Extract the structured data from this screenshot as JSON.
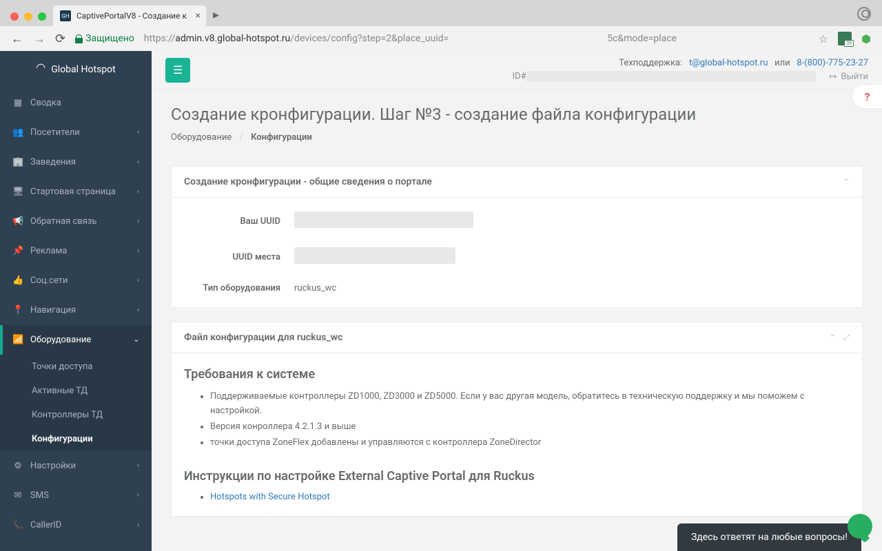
{
  "browser": {
    "tab_title": "CaptivePortalV8 - Создание к",
    "tab_favicon": "GH",
    "secure_label": "Защищено",
    "url_prefix": "https://",
    "url_host": "admin.v8.global-hotspot.ru",
    "url_path": "/devices/config?step=2&place_uuid=",
    "url_suffix": "5c&mode=place",
    "ext_badge": "39"
  },
  "sidebar": {
    "brand": "Global Hotspot",
    "items": [
      {
        "icon": "▦",
        "label": "Сводка",
        "expandable": false
      },
      {
        "icon": "👥",
        "label": "Посетители",
        "expandable": true
      },
      {
        "icon": "🏢",
        "label": "Заведения",
        "expandable": true
      },
      {
        "icon": "🖥",
        "label": "Стартовая страница",
        "expandable": true
      },
      {
        "icon": "📢",
        "label": "Обратная связь",
        "expandable": true
      },
      {
        "icon": "📌",
        "label": "Реклама",
        "expandable": true
      },
      {
        "icon": "👍",
        "label": "Соц.сети",
        "expandable": true
      },
      {
        "icon": "📍",
        "label": "Навигация",
        "expandable": true
      }
    ],
    "active": {
      "icon": "📶",
      "label": "Оборудование",
      "sub": [
        {
          "label": "Точки доступа"
        },
        {
          "label": "Активные ТД"
        },
        {
          "label": "Контроллеры ТД"
        },
        {
          "label": "Конфигурации",
          "active": true
        }
      ]
    },
    "items_after": [
      {
        "icon": "⚙",
        "label": "Настройки",
        "expandable": true
      },
      {
        "icon": "✉",
        "label": "SMS",
        "expandable": true
      },
      {
        "icon": "📞",
        "label": "CallerID",
        "expandable": true
      }
    ]
  },
  "topbar": {
    "support_label": "Техподдержка:",
    "support_email": "t@global-hotspot.ru",
    "support_or": "или",
    "support_phone": "8-(800)-775-23-27",
    "id_label": "ID#",
    "logout": "Выйти"
  },
  "help_btn": "?",
  "page": {
    "title": "Создание кронфигурации. Шаг №3 - создание файла конфигурации",
    "breadcrumb_root": "Оборудование",
    "breadcrumb_current": "Конфигурации"
  },
  "panel1": {
    "title": "Создание кронфигурации - общие сведения о портале",
    "uuid_label": "Ваш UUID",
    "place_uuid_label": "UUID места",
    "eq_type_label": "Тип оборудования",
    "eq_type_value": "ruckus_wc"
  },
  "panel2": {
    "title": "Файл конфигурации для ruckus_wc",
    "req_heading": "Требования к системе",
    "reqs": [
      "Поддерживаемые контроллеры ZD1000, ZD3000 и ZD5000. Если у вас другая модель, обратитесь в техническую поддержку и мы поможем с настройкой.",
      "Версия конроллера 4.2.1.3 и выше",
      "точки доступа ZoneFlex добавлены и управляются с контроллера ZoneDirector"
    ],
    "instr_heading": "Инструкции по настройке External Captive Portal для Ruckus",
    "links": [
      "Hotspots with Secure Hotspot"
    ]
  },
  "chat": {
    "text": "Здесь ответят на любые вопросы!"
  }
}
